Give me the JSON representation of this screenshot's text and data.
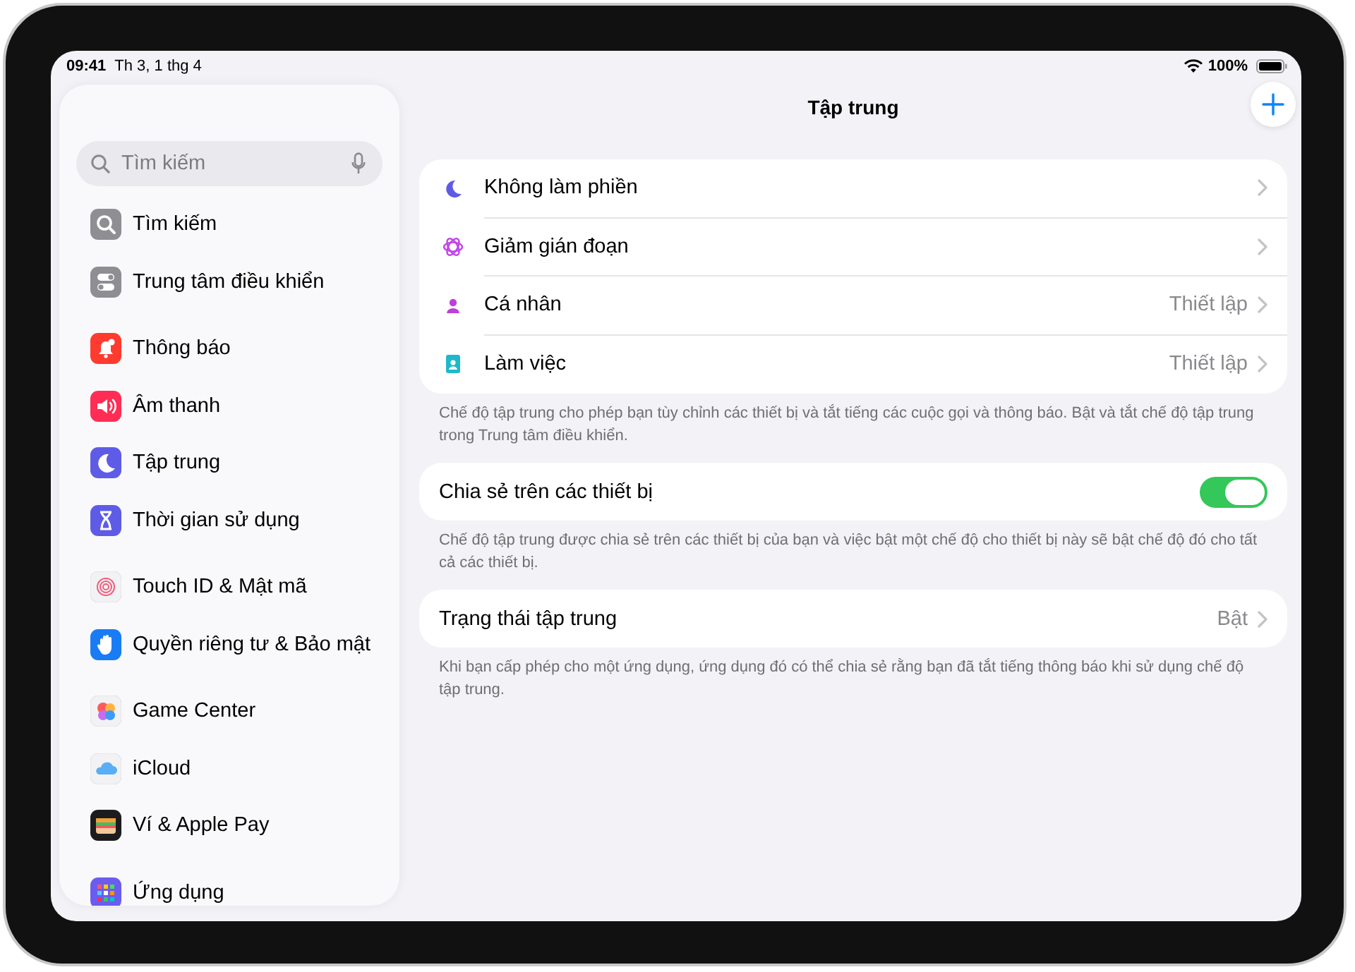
{
  "status_bar": {
    "time": "09:41",
    "date": "Th 3, 1 thg 4",
    "battery": "100%"
  },
  "sidebar": {
    "search": {
      "placeholder": "Tìm kiếm"
    },
    "groups": [
      [
        {
          "label": "Tìm kiếm",
          "color": "#8e8e93",
          "selected": false
        },
        {
          "label": "Trung tâm điều khiển",
          "color": "#8e8e93",
          "selected": false
        }
      ],
      [
        {
          "label": "Thông báo",
          "color": "#ff3b30",
          "selected": false
        },
        {
          "label": "Âm thanh",
          "color": "#ff2d55",
          "selected": false
        },
        {
          "label": "Tập trung",
          "color": "#5e5ce6",
          "selected": false
        },
        {
          "label": "Thời gian sử dụng",
          "color": "#5e5ce6",
          "selected": false
        }
      ],
      [
        {
          "label": "Touch ID & Mật mã",
          "color": "#f2f2f5",
          "selected": false
        },
        {
          "label": "Quyền riêng tư & Bảo mật",
          "color": "#1a7cf5",
          "selected": false
        }
      ],
      [
        {
          "label": "Game Center",
          "color": "#f2f2f5",
          "selected": false
        },
        {
          "label": "iCloud",
          "color": "#f2f2f5",
          "selected": false
        },
        {
          "label": "Ví & Apple Pay",
          "color": "#1c1c1e",
          "selected": false
        }
      ],
      [
        {
          "label": "Ứng dụng",
          "color": "#6b5cf0",
          "selected": false
        }
      ]
    ]
  },
  "main": {
    "title": "Tập trung",
    "focus_modes": [
      {
        "label": "Không làm phiền",
        "color": "#5e5ce6"
      },
      {
        "label": "Giảm gián đoạn",
        "color": "#c045e8"
      },
      {
        "label": "Cá nhân",
        "value": "Thiết lập",
        "color": "#bf3fd9"
      },
      {
        "label": "Làm việc",
        "value": "Thiết lập",
        "color": "#1fb8c9"
      }
    ],
    "focus_note": "Chế độ tập trung cho phép bạn tùy chỉnh các thiết bị và tắt tiếng các cuộc gọi và thông báo. Bật và tắt chế độ tập trung trong Trung tâm điều khiển.",
    "share": {
      "label": "Chia sẻ trên các thiết bị",
      "on": true
    },
    "share_note": "Chế độ tập trung được chia sẻ trên các thiết bị của bạn và việc bật một chế độ cho thiết bị này sẽ bật chế độ đó cho tất cả các thiết bị.",
    "status": {
      "label": "Trạng thái tập trung",
      "value": "Bật"
    },
    "status_note": "Khi bạn cấp phép cho một ứng dụng, ứng dụng đó có thể chia sẻ rằng bạn đã tắt tiếng thông báo khi sử dụng chế độ tập trung."
  }
}
